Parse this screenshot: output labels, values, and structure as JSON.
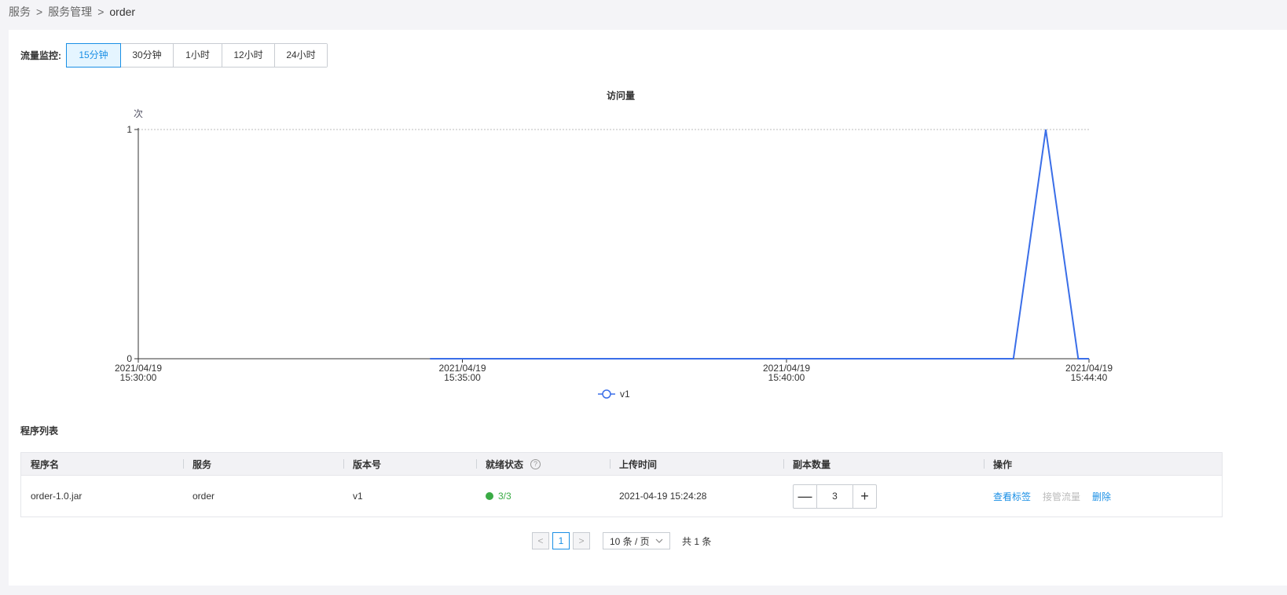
{
  "breadcrumb": [
    {
      "label": "服务"
    },
    {
      "label": "服务管理"
    },
    {
      "label": "order"
    }
  ],
  "breadcrumb_sep": ">",
  "monitor": {
    "label": "流量监控:",
    "ranges": [
      "15分钟",
      "30分钟",
      "1小时",
      "12小时",
      "24小时"
    ],
    "active_index": 0
  },
  "chart_data": {
    "type": "line",
    "title": "访问量",
    "ylabel": "次",
    "ylim": [
      0,
      1
    ],
    "yticks": [
      "0",
      "1"
    ],
    "xticks": [
      {
        "date": "2021/04/19",
        "time": "15:30:00"
      },
      {
        "date": "2021/04/19",
        "time": "15:35:00"
      },
      {
        "date": "2021/04/19",
        "time": "15:40:00"
      },
      {
        "date": "2021/04/19",
        "time": "15:44:40"
      }
    ],
    "xlim": [
      "15:30:00",
      "15:44:40"
    ],
    "grid": "dotted at top tick",
    "legend": "bottom-center",
    "series": [
      {
        "name": "v1",
        "color": "#3a6ee8",
        "points": [
          {
            "x": "15:34:30",
            "y": 0
          },
          {
            "x": "15:43:30",
            "y": 0
          },
          {
            "x": "15:44:00",
            "y": 1
          },
          {
            "x": "15:44:30",
            "y": 0
          },
          {
            "x": "15:44:40",
            "y": 0
          }
        ]
      }
    ]
  },
  "program_list": {
    "title": "程序列表",
    "columns": [
      "程序名",
      "服务",
      "版本号",
      "就绪状态",
      "上传时间",
      "副本数量",
      "操作"
    ],
    "help_icon": "?",
    "rows": [
      {
        "name": "order-1.0.jar",
        "service": "order",
        "version": "v1",
        "ready": "3/3",
        "uploaded": "2021-04-19 15:24:28",
        "replicas": "3",
        "actions": [
          "查看标签",
          "接管流量",
          "删除"
        ]
      }
    ],
    "stepper_minus": "—",
    "stepper_plus": "+"
  },
  "pagination": {
    "prev": "<",
    "next": ">",
    "current": "1",
    "page_size": "10 条 / 页",
    "total": "共 1 条"
  },
  "colors": {
    "accent": "#1a8fe5",
    "series": "#3a6ee8",
    "ready": "#3aab45"
  }
}
